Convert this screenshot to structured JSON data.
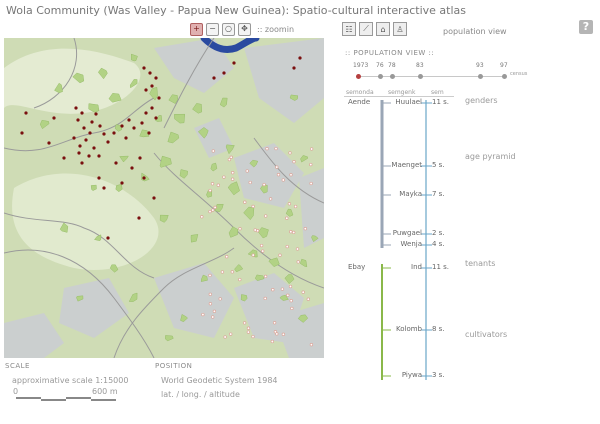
{
  "app": {
    "title": "Wola Community (Was Valley - Papua New Guinea): Spatio-cultural interactive atlas",
    "help_label": "?"
  },
  "zoom": {
    "buttons": [
      {
        "name": "zoom-in-icon",
        "glyph": "+"
      },
      {
        "name": "zoom-out-icon",
        "glyph": "−"
      },
      {
        "name": "zoom-reset-icon",
        "glyph": "○"
      },
      {
        "name": "pan-icon",
        "glyph": "✥"
      }
    ],
    "label": ":: zoomin"
  },
  "map": {
    "colors": {
      "base_green": "#cfdcb5",
      "light_green": "#e8efd9",
      "grey_ridge": "#cbcfcf",
      "river": "#2a4aa0",
      "garden": "#b2d285",
      "garden_edge": "#97bd6a",
      "house": "#7a0f0f",
      "hamlet": "#dca59a",
      "path": "#9a9a9a"
    }
  },
  "scale": {
    "heading": "SCALE",
    "text": "approximative scale 1:15000",
    "zero": "0",
    "max": "600 m"
  },
  "position": {
    "heading": "POSITION",
    "system": "World Geodetic System 1984",
    "coords": "lat. / long. / altitude"
  },
  "view": {
    "icons": [
      {
        "name": "list-view-icon",
        "glyph": "☷"
      },
      {
        "name": "chart-view-icon",
        "glyph": "⟋"
      },
      {
        "name": "house-view-icon",
        "glyph": "⌂"
      },
      {
        "name": "population-view-icon",
        "glyph": "♙"
      }
    ],
    "label": "population view"
  },
  "population": {
    "heading": ":: POPULATION VIEW ::",
    "census_label": "census",
    "years": [
      "1973",
      "76",
      "78",
      "83",
      "93",
      "97"
    ],
    "selected_year": "1973",
    "columns": [
      "semonda",
      "semgenk",
      "sem"
    ],
    "rows": [
      {
        "semonda": "Aende",
        "semgenk": "Huulael",
        "sem": "11 s."
      },
      {
        "semonda": "",
        "semgenk": "Maenget",
        "sem": "5 s."
      },
      {
        "semonda": "",
        "semgenk": "Mayka",
        "sem": "7 s."
      },
      {
        "semonda": "",
        "semgenk": "Puwgael",
        "sem": "2 s."
      },
      {
        "semonda": "",
        "semgenk": "Wenja",
        "sem": "4 s."
      },
      {
        "semonda": "Ebay",
        "semgenk": "Ind",
        "sem": "11 s."
      },
      {
        "semonda": "",
        "semgenk": "Kolomb",
        "sem": "8 s."
      },
      {
        "semonda": "",
        "semgenk": "Piywa",
        "sem": "3 s."
      }
    ],
    "categories": [
      "genders",
      "age pyramid",
      "tenants",
      "cultivators"
    ],
    "colors": {
      "aende": "#9aa6b6",
      "ebay": "#8ab84a",
      "sem": "#6aa6c8"
    }
  }
}
